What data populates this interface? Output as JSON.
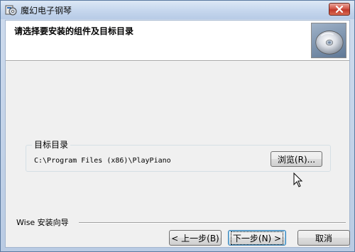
{
  "window": {
    "title": "魔幻电子钢琴"
  },
  "header": {
    "title": "请选择要安装的组件及目标目录"
  },
  "destination": {
    "group_label": "目标目录",
    "path": "C:\\Program Files (x86)\\PlayPiano",
    "browse_label": "浏览(R)..."
  },
  "footer": {
    "wise_label": "Wise 安装向导",
    "back_label": "< 上一步(B)",
    "next_label": "下一步(N) >",
    "cancel_label": "取消"
  },
  "colors": {
    "close_button": "#c0392b",
    "default_button_border": "#3c7fb1"
  },
  "icons": [
    "installer-app-icon",
    "close-icon",
    "cd-disc-icon",
    "mouse-cursor-icon"
  ]
}
